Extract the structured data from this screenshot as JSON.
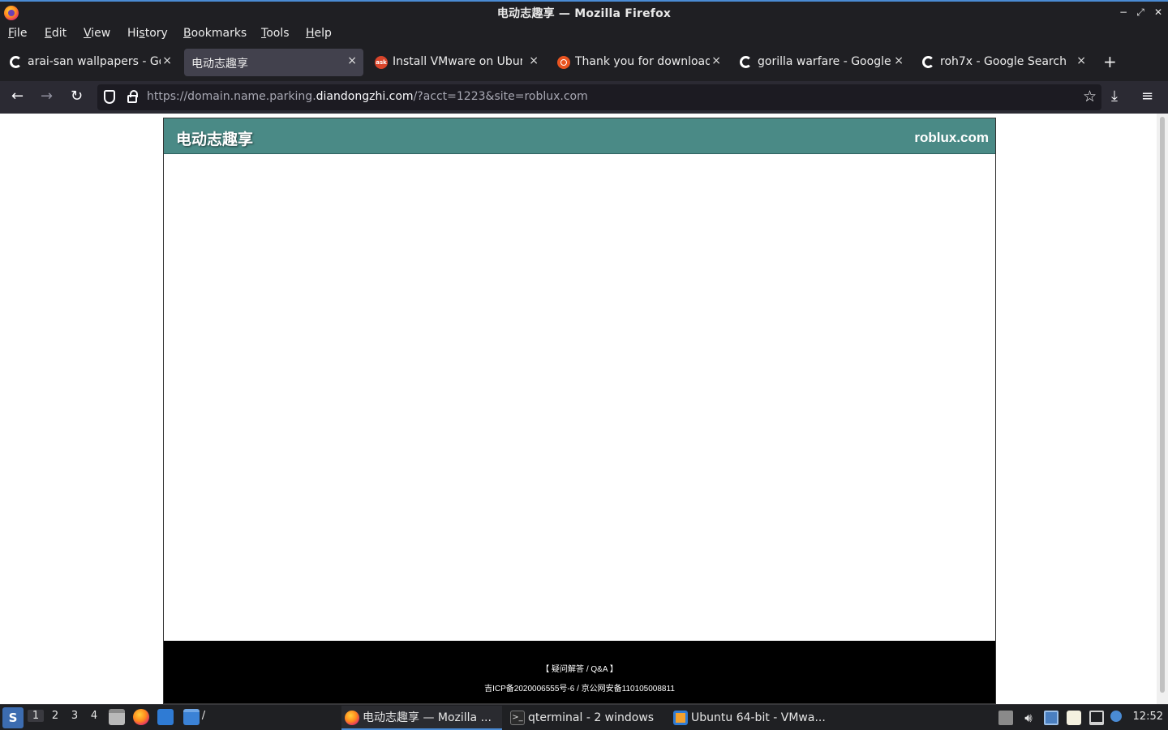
{
  "window": {
    "title": "电动志趣享 — Mozilla Firefox",
    "minimize_glyph": "−",
    "maximize_glyph": "⤢",
    "close_glyph": "✕"
  },
  "menu": {
    "file": {
      "pre": "",
      "u": "F",
      "post": "ile"
    },
    "edit": {
      "pre": "",
      "u": "E",
      "post": "dit"
    },
    "view": {
      "pre": "",
      "u": "V",
      "post": "iew"
    },
    "history": {
      "pre": "Hi",
      "u": "s",
      "post": "tory"
    },
    "bookmarks": {
      "pre": "",
      "u": "B",
      "post": "ookmarks"
    },
    "tools": {
      "pre": "",
      "u": "T",
      "post": "ools"
    },
    "help": {
      "pre": "",
      "u": "H",
      "post": "elp"
    }
  },
  "tabs": [
    {
      "label": "arai-san wallpapers - Goo",
      "icon": "google-icon",
      "active": false
    },
    {
      "label": "电动志趣享",
      "icon": "none",
      "active": true
    },
    {
      "label": "Install VMware on Ubunt",
      "icon": "ask-icon",
      "active": false
    },
    {
      "label": "Thank you for downloadi",
      "icon": "ubuntu-icon",
      "active": false
    },
    {
      "label": "gorilla warfare - Google S",
      "icon": "google-icon",
      "active": false
    },
    {
      "label": "roh7x - Google Search",
      "icon": "google-icon",
      "active": false
    }
  ],
  "tab_close_glyph": "×",
  "new_tab_glyph": "+",
  "nav": {
    "back_glyph": "←",
    "forward_glyph": "→",
    "reload_glyph": "↻",
    "url_prefix": "https://domain.name.parking.",
    "url_domain": "diandongzhi.com",
    "url_suffix": "/?acct=1223&site=roblux.com",
    "bookmark_glyph": "☆",
    "download_glyph": "⤓",
    "menu_glyph": "≡"
  },
  "page": {
    "site_title": "电动志趣享",
    "site_domain": "roblux.com",
    "footer_qa": "【 疑问解答 / Q&A 】",
    "footer_icp": "吉ICP备2020006555号-6 / 京公网安备110105008811",
    "header_color": "#4a8a86"
  },
  "taskbar": {
    "start_glyph": "S",
    "workspaces": [
      "1",
      "2",
      "3",
      "4"
    ],
    "active_workspace": "1",
    "folder_suffix": "/",
    "tasks": [
      {
        "label": "电动志趣享 — Mozilla ...",
        "icon": "firefox-icon",
        "active": true
      },
      {
        "label": "qterminal - 2 windows",
        "icon": "terminal-icon",
        "active": false
      },
      {
        "label": "Ubuntu 64-bit - VMwa...",
        "icon": "vmware-icon",
        "active": false
      }
    ],
    "clock": "12:52"
  }
}
